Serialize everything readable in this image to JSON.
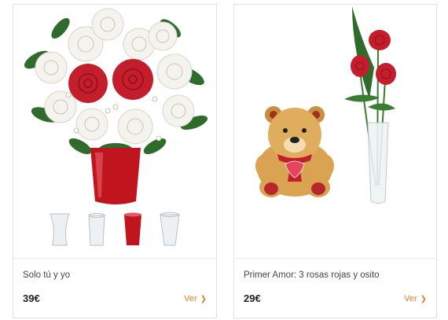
{
  "products": [
    {
      "image_alt": "",
      "title": "Solo tú y yo",
      "price": "39€",
      "link_label": "Ver",
      "vase_options": [
        "hourglass-glass-vase",
        "cylinder-glass-vase",
        "red-glass-vase",
        "tall-glass-vase"
      ]
    },
    {
      "image_alt": "",
      "title": "Primer Amor: 3 rosas rojas y osito",
      "price": "29€",
      "link_label": "Ver"
    }
  ],
  "colors": {
    "accent": "#e77e2a",
    "rose_red": "#c41e2c",
    "rose_white": "#f4f3ee",
    "leaf_green": "#2f6b2a",
    "vase_red": "#c0141f",
    "bear_tan": "#d9a352"
  }
}
